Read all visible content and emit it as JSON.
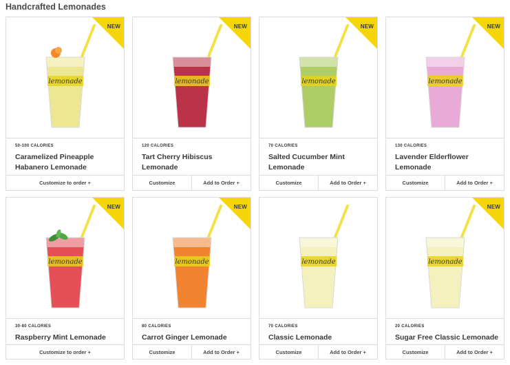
{
  "section": {
    "title": "Handcrafted Lemonades"
  },
  "badge_label": "NEW",
  "colors": {
    "badge": "#f5d60a",
    "straw": "#f2e24a",
    "cup_label": "#e9d21a"
  },
  "cup_text": "lemonade",
  "products": [
    {
      "calories": "50-100 CALORIES",
      "name": "Caramelized Pineapple Habanero Lemonade",
      "is_new": true,
      "buttons": [
        "Customize to order +"
      ],
      "liquid": "#e9e58a",
      "garnish": "orange"
    },
    {
      "calories": "120 CALORIES",
      "name": "Tart Cherry Hibiscus Lemonade",
      "is_new": true,
      "buttons": [
        "Customize",
        "Add to Order +"
      ],
      "liquid": "#b5223a",
      "garnish": ""
    },
    {
      "calories": "70 CALORIES",
      "name": "Salted Cucumber Mint Lemonade",
      "is_new": true,
      "buttons": [
        "Customize",
        "Add to Order +"
      ],
      "liquid": "#a8c95a",
      "garnish": ""
    },
    {
      "calories": "130 CALORIES",
      "name": "Lavender Elderflower Lemonade",
      "is_new": true,
      "buttons": [
        "Customize",
        "Add to Order +"
      ],
      "liquid": "#e8a3d4",
      "garnish": ""
    },
    {
      "calories": "30-80 CALORIES",
      "name": "Raspberry Mint Lemonade",
      "is_new": true,
      "buttons": [
        "Customize to order +"
      ],
      "liquid": "#e2404a",
      "garnish": "mint"
    },
    {
      "calories": "80 CALORIES",
      "name": "Carrot Ginger Lemonade",
      "is_new": true,
      "buttons": [
        "Customize",
        "Add to Order +"
      ],
      "liquid": "#f07a1e",
      "garnish": ""
    },
    {
      "calories": "70 CALORIES",
      "name": "Classic Lemonade",
      "is_new": false,
      "buttons": [
        "Customize",
        "Add to Order +"
      ],
      "liquid": "#f3f0b8",
      "garnish": ""
    },
    {
      "calories": "20 CALORIES",
      "name": "Sugar Free Classic Lemonade",
      "is_new": true,
      "buttons": [
        "Customize",
        "Add to Order +"
      ],
      "liquid": "#f3f0b8",
      "garnish": ""
    }
  ]
}
